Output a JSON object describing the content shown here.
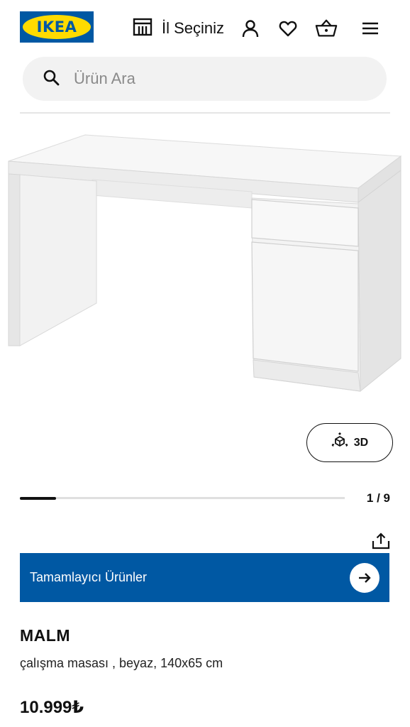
{
  "header": {
    "logo_text": "IKEA",
    "store_label": "İl Seçiniz",
    "icons": [
      "store-icon",
      "account-icon",
      "heart-icon",
      "basket-icon",
      "menu-icon"
    ]
  },
  "search": {
    "placeholder": "Ürün Ara",
    "value": ""
  },
  "gallery": {
    "btn_3d_label": "3D",
    "counter": "1 / 9",
    "current": 1,
    "total": 9
  },
  "banner": {
    "label": "Tamamlayıcı Ürünler"
  },
  "product": {
    "name": "MALM",
    "description": "çalışma masası , beyaz, 140x65 cm",
    "price": "10.999₺"
  },
  "colors": {
    "brand_blue": "#0058a3",
    "brand_yellow": "#ffdb00",
    "search_bg": "#f2f2f2"
  }
}
